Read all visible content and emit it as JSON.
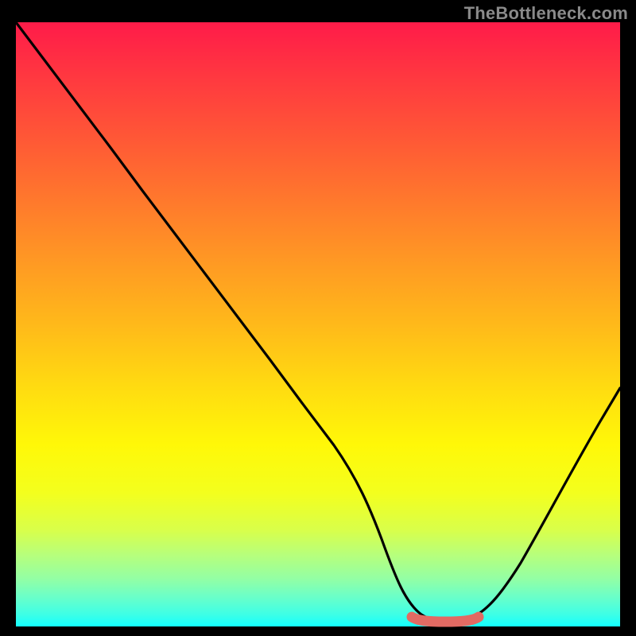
{
  "watermark": "TheBottleneck.com",
  "chart_data": {
    "type": "line",
    "title": "",
    "xlabel": "",
    "ylabel": "",
    "xlim": [
      0,
      100
    ],
    "ylim": [
      0,
      100
    ],
    "series": [
      {
        "name": "bottleneck-curve",
        "x": [
          0,
          5,
          10,
          15,
          20,
          25,
          30,
          35,
          40,
          45,
          50,
          55,
          58,
          62,
          66,
          70,
          74,
          78,
          82,
          86,
          90,
          94,
          98,
          100
        ],
        "y": [
          100,
          93,
          86,
          79,
          72,
          65,
          58,
          51,
          44,
          37,
          30,
          23,
          17,
          11,
          6,
          3,
          1,
          1,
          3,
          8,
          15,
          24,
          34,
          40
        ]
      },
      {
        "name": "poor-fit-band",
        "x": [
          66,
          78
        ],
        "y": [
          1,
          1
        ]
      }
    ],
    "gradient_stops": [
      {
        "pos": 0,
        "color": "#ff1b49"
      },
      {
        "pos": 50,
        "color": "#ffb91a"
      },
      {
        "pos": 78,
        "color": "#f3ff1e"
      },
      {
        "pos": 100,
        "color": "#13ffff"
      }
    ],
    "band_color": "#e26a63"
  }
}
